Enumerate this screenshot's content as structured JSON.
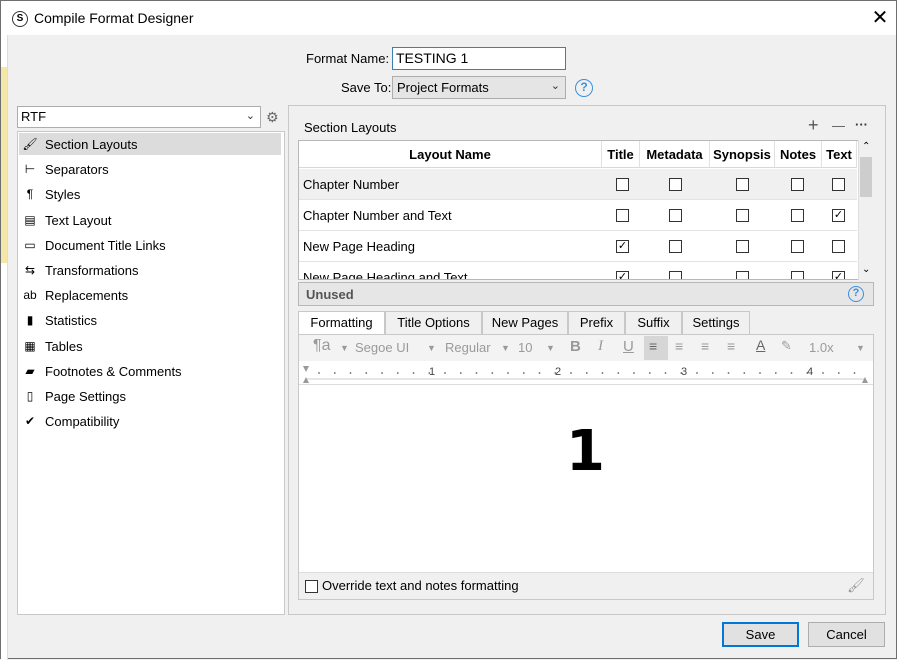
{
  "window": {
    "title": "Compile Format Designer",
    "app_icon_letter": "S",
    "close_glyph": "✕"
  },
  "header": {
    "format_name_label": "Format Name:",
    "format_name_value": "TESTING 1",
    "save_to_label": "Save To:",
    "save_to_value": "Project Formats",
    "help_glyph": "?"
  },
  "left": {
    "output_select": "RTF",
    "items": [
      {
        "label": "Section Layouts",
        "icon": "section-layouts-icon",
        "glyph": "🖌"
      },
      {
        "label": "Separators",
        "icon": "separators-icon",
        "glyph": "⊢"
      },
      {
        "label": "Styles",
        "icon": "styles-icon",
        "glyph": "¶"
      },
      {
        "label": "Text Layout",
        "icon": "text-layout-icon",
        "glyph": "▤"
      },
      {
        "label": "Document Title Links",
        "icon": "document-title-links-icon",
        "glyph": "▭"
      },
      {
        "label": "Transformations",
        "icon": "transformations-icon",
        "glyph": "⇆"
      },
      {
        "label": "Replacements",
        "icon": "replacements-icon",
        "glyph": "ab"
      },
      {
        "label": "Statistics",
        "icon": "statistics-icon",
        "glyph": "▮"
      },
      {
        "label": "Tables",
        "icon": "tables-icon",
        "glyph": "▦"
      },
      {
        "label": "Footnotes & Comments",
        "icon": "footnotes-icon",
        "glyph": "▰"
      },
      {
        "label": "Page Settings",
        "icon": "page-settings-icon",
        "glyph": "▯"
      },
      {
        "label": "Compatibility",
        "icon": "compatibility-icon",
        "glyph": "✔"
      }
    ]
  },
  "section_layouts": {
    "heading": "Section Layouts",
    "add_glyph": "+",
    "remove_glyph": "—",
    "more_glyph": "···",
    "columns": [
      "Layout Name",
      "Title",
      "Metadata",
      "Synopsis",
      "Notes",
      "Text"
    ],
    "rows": [
      {
        "name": "Chapter Number",
        "checks": [
          false,
          false,
          false,
          false,
          false
        ]
      },
      {
        "name": "Chapter Number and Text",
        "checks": [
          false,
          false,
          false,
          false,
          true
        ]
      },
      {
        "name": "New Page Heading",
        "checks": [
          true,
          false,
          false,
          false,
          false
        ]
      },
      {
        "name": "New Page Heading and Text",
        "checks": [
          true,
          false,
          false,
          false,
          true
        ]
      }
    ],
    "unused_label": "Unused"
  },
  "tabs": [
    "Formatting",
    "Title Options",
    "New Pages",
    "Prefix",
    "Suffix",
    "Settings"
  ],
  "toolbar": {
    "para_glyph": "¶a",
    "font": "Segoe UI",
    "weight": "Regular",
    "size": "10",
    "bold": "B",
    "italic": "I",
    "underline": "U",
    "line_spacing": "1.0x"
  },
  "ruler": {
    "marks": [
      "1",
      "2",
      "3",
      "4"
    ]
  },
  "preview_text": "1",
  "override_label": "Override text and notes formatting",
  "buttons": {
    "save": "Save",
    "cancel": "Cancel"
  }
}
